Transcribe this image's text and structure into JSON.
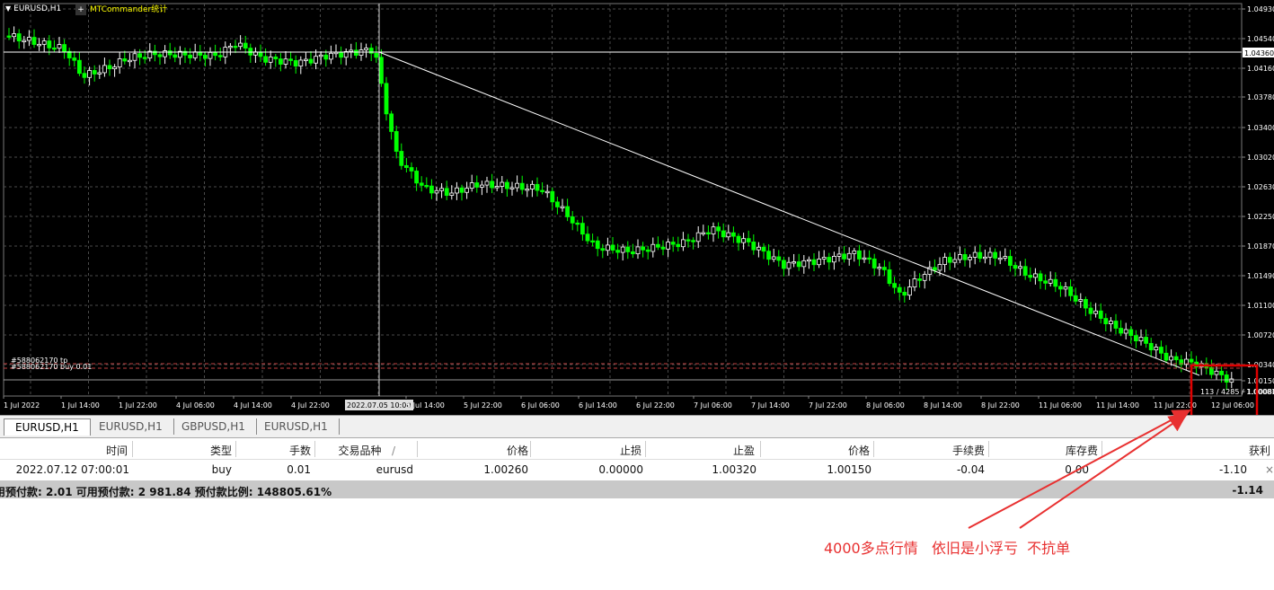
{
  "chart": {
    "symbol_label": "EURUSD,H1",
    "indicator_label": "MTCommander统计",
    "plus_glyph": "+",
    "price_labels": [
      "1.04930",
      "1.04540",
      "1.04160",
      "1.03780",
      "1.03400",
      "1.03020",
      "1.02630",
      "1.02250",
      "1.01870",
      "1.01490",
      "1.01100",
      "1.00720",
      "1.00340",
      "1.00150",
      "1.00080"
    ],
    "highlighted_price": "1.04360",
    "time_labels": [
      "1 Jul 2022",
      "1 Jul 14:00",
      "1 Jul 22:00",
      "4 Jul 06:00",
      "4 Jul 14:00",
      "4 Jul 22:00",
      "2022.07.05 10:00",
      "5 Jul 14:00",
      "5 Jul 22:00",
      "6 Jul 06:00",
      "6 Jul 14:00",
      "6 Jul 22:00",
      "7 Jul 06:00",
      "7 Jul 14:00",
      "7 Jul 22:00",
      "8 Jul 06:00",
      "8 Jul 14:00",
      "8 Jul 22:00",
      "11 Jul 06:00",
      "11 Jul 14:00",
      "11 Jul 22:00",
      "12 Jul 06:00"
    ],
    "order_tp_label": "#588062170 tp",
    "order_label": "#588062170 buy 0.01",
    "crosshair_readout": "113 / 4285 / 1.00081",
    "colors": {
      "bull": "#ffffff",
      "bear": "#00ff00",
      "grid": "#4a4a4a",
      "bg": "#000000",
      "highlight_box": "#e00000"
    }
  },
  "tabs": [
    "EURUSD,H1",
    "EURUSD,H1",
    "GBPUSD,H1",
    "EURUSD,H1"
  ],
  "table": {
    "headers": [
      "时间",
      "类型",
      "手数",
      "交易品种",
      "价格",
      "止损",
      "止盈",
      "价格",
      "手续费",
      "库存费",
      "获利"
    ],
    "sort_glyph": "/",
    "row": [
      "2022.07.12 07:00:01",
      "buy",
      "0.01",
      "eurusd",
      "1.00260",
      "0.00000",
      "1.00320",
      "1.00150",
      "-0.04",
      "0.00",
      "-1.10"
    ],
    "close_glyph": "×",
    "summary_text": "用预付款: 2.01  可用预付款: 2 981.84  预付款比例: 148805.61%",
    "summary_total": "-1.14"
  },
  "annotation": "4000多点行情   依旧是小浮亏  不抗单"
}
